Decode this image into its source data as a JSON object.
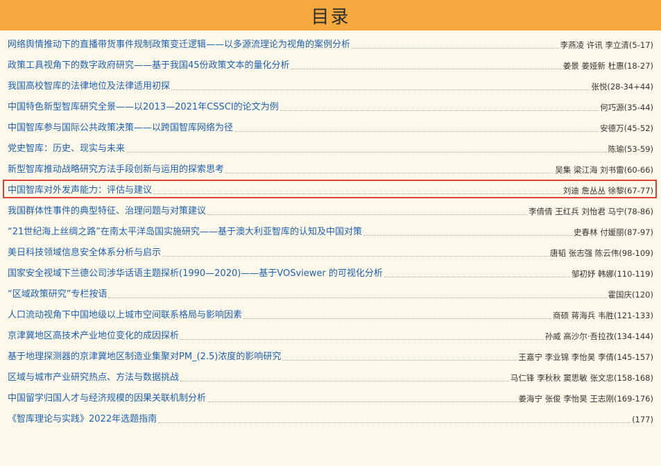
{
  "header": {
    "title": "目录"
  },
  "colors": {
    "header_bg": "#f5a93f",
    "page_bg": "#fdf9ea",
    "title_link": "#1f5fb0",
    "highlight": "#e0403a"
  },
  "items": [
    {
      "title": "网络舆情推动下的直播带货事件规制政策变迁逻辑——以多源流理论为视角的案例分析",
      "authors": "李燕凌 许讯 李立清(5-17)"
    },
    {
      "title": "政策工具视角下的数字政府研究——基于我国45份政策文本的量化分析",
      "authors": "姜景 姜娅新 杜惠(18-27)"
    },
    {
      "title": "我国高校智库的法律地位及法律适用初探",
      "authors": "张悦(28-34+44)"
    },
    {
      "title": "中国特色新型智库研究全景——以2013—2021年CSSCI的论文为例",
      "authors": "何巧源(35-44)"
    },
    {
      "title": "中国智库参与国际公共政策决策——以跨国智库网络为径",
      "authors": "安德万(45-52)"
    },
    {
      "title": "党史智库：历史、现实与未来",
      "authors": "陈瑜(53-59)"
    },
    {
      "title": "新型智库推动战略研究方法手段创新与运用的探索思考",
      "authors": "吴集 梁江海 刘书雷(60-66)"
    },
    {
      "title": "中国智库对外发声能力：评估与建议",
      "authors": "刘迪 詹丛丛 徐黎(67-77)"
    },
    {
      "title": "我国群体性事件的典型特征、治理问题与对策建议",
      "authors": "李倩倩 王红兵 刘怡君 马宁(78-86)"
    },
    {
      "title": "“21世纪海上丝绸之路”在南太平洋岛国实施研究——基于澳大利亚智库的认知及中国对策",
      "authors": "史春林 付媛丽(87-97)"
    },
    {
      "title": "美日科技领域信息安全体系分析与启示",
      "authors": "唐韬 张志强 陈云伟(98-109)"
    },
    {
      "title": "国家安全视域下兰德公司涉华话语主题探析(1990—2020)——基于VOSviewer 的可视化分析",
      "authors": "邹初妤 韩娜(110-119)"
    },
    {
      "title": "“区域政策研究”专栏按语",
      "authors": "霍国庆(120)"
    },
    {
      "title": "人口流动视角下中国地级以上城市空间联系格局与影响因素",
      "authors": "商硕 蒋海兵 韦胜(121-133)"
    },
    {
      "title": "京津冀地区高技术产业地位变化的成因探析",
      "authors": "孙威 高沙尔·吾拉孜(134-144)"
    },
    {
      "title": "基于地理探测器的京津冀地区制造业集聚对PM_(2.5)浓度的影响研究",
      "authors": "王嘉宁 李业锦 李怡昊 李倩(145-157)"
    },
    {
      "title": "区域与城市产业研究热点、方法与数据挑战",
      "authors": "马仁锋 李秋秋 窦思敏 张文忠(158-168)"
    },
    {
      "title": "中国留学归国人才与经济规模的因果关联机制分析",
      "authors": "姜海宁 张俊 李怡昊 王志刚(169-176)"
    },
    {
      "title": "《智库理论与实践》2022年选题指南",
      "authors": "(177)"
    }
  ]
}
